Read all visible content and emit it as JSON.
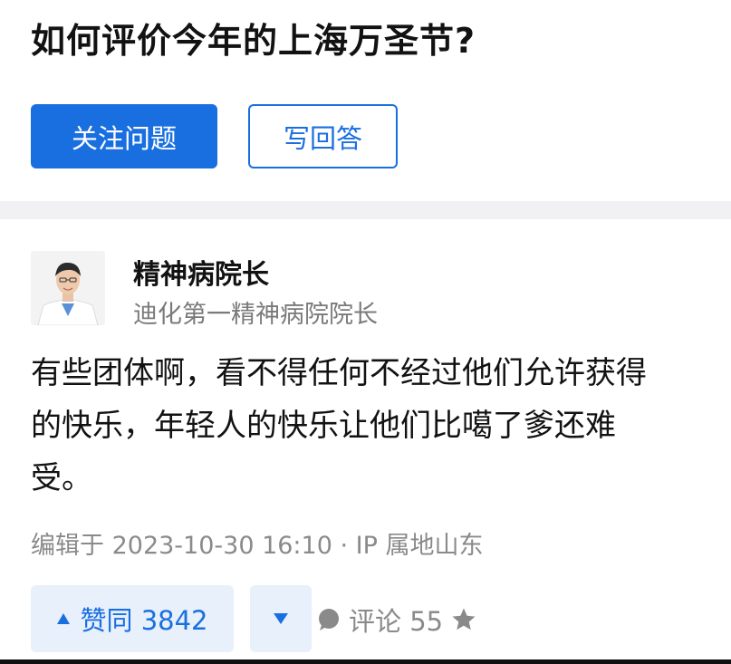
{
  "question": {
    "title": "如何评价今年的上海万圣节?",
    "follow_label": "关注问题",
    "answer_label": "写回答"
  },
  "answer": {
    "author_name": "精神病院长",
    "author_bio": "迪化第一精神病院院长",
    "content_lines": [
      "有些团体啊，看不得任何不经过他们允许获得",
      "的快乐，年轻人的快乐让他们比噶了爹还难",
      "受。"
    ],
    "meta": "编辑于 2023-10-30 16:10 · IP 属地山东"
  },
  "actions": {
    "upvote_label": "赞同 3842",
    "comment_label": "评论 55"
  },
  "colors": {
    "accent": "#1a6fe0",
    "accent_light": "#e8f0fb",
    "divider": "#f1f1f3",
    "meta_text": "#8a8a8a"
  },
  "icons": [
    "upvote-triangle-icon",
    "downvote-triangle-icon",
    "comment-bubble-icon",
    "star-icon"
  ]
}
